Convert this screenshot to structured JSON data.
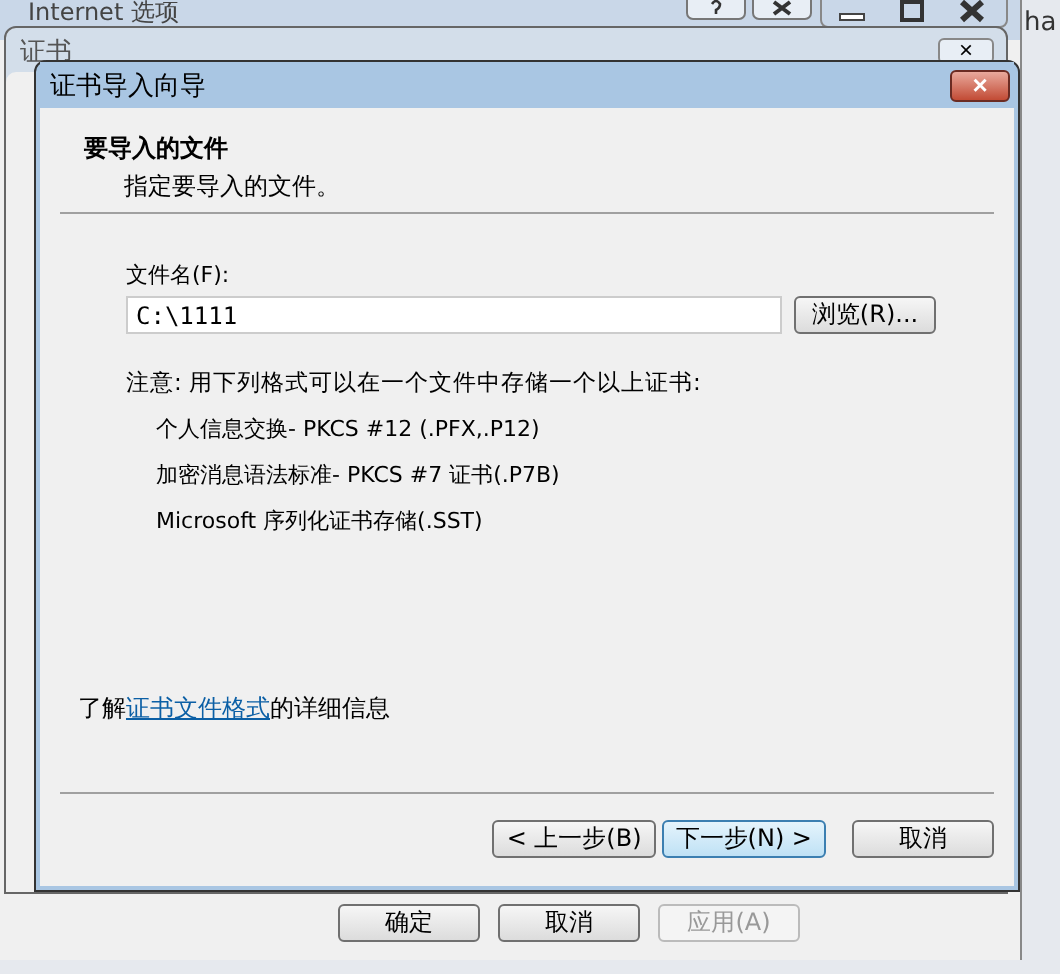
{
  "background_windows": [
    {
      "title": "Internet 选项"
    },
    {
      "title": "证书",
      "close": "×"
    }
  ],
  "edge_text": "ha",
  "dialog": {
    "title": "证书导入向导",
    "close": "×",
    "header": {
      "title": "要导入的文件",
      "subtitle": "指定要导入的文件。"
    },
    "file_field": {
      "label": "文件名(F):",
      "value": "C:\\1111",
      "browse": "浏览(R)..."
    },
    "note": "注意: 用下列格式可以在一个文件中存储一个以上证书:",
    "formats": [
      "个人信息交换- PKCS #12 (.PFX,.P12)",
      "加密消息语法标准- PKCS #7 证书(.P7B)",
      "Microsoft 序列化证书存储(.SST)"
    ],
    "info": {
      "before": "了解",
      "link": "证书文件格式",
      "after": "的详细信息"
    },
    "buttons": [
      {
        "label": "< 上一步(B)",
        "focused": false
      },
      {
        "label": "下一步(N) >",
        "focused": true
      },
      {
        "label": "取消",
        "focused": false
      }
    ]
  },
  "bottom_buttons": [
    {
      "label": "确定",
      "disabled": false
    },
    {
      "label": "取消",
      "disabled": false
    },
    {
      "label": "应用(A)",
      "disabled": true
    }
  ]
}
